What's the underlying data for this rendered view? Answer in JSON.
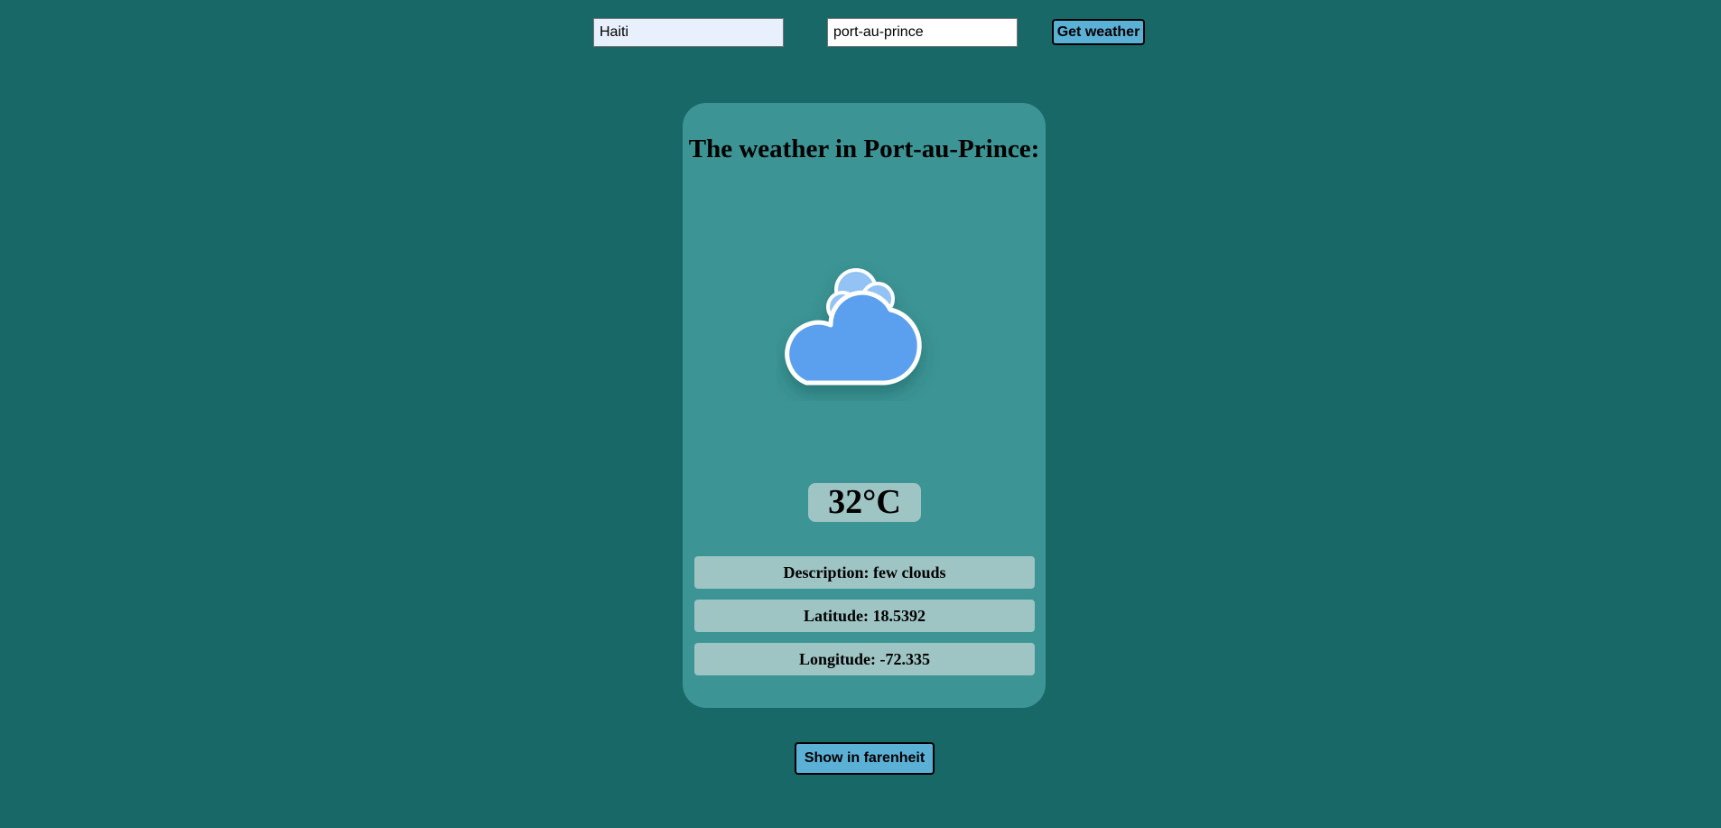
{
  "search": {
    "country_value": "Haiti",
    "city_value": "port-au-prince",
    "submit_label": "Get weather"
  },
  "weather": {
    "title": "The weather in Port-au-Prince:",
    "icon": "few-clouds-icon",
    "temperature": "32°C",
    "description": "Description: few clouds",
    "latitude": "Latitude: 18.5392",
    "longitude": "Longitude: -72.335"
  },
  "actions": {
    "toggle_unit_label": "Show in farenheit"
  },
  "colors": {
    "background": "#186868",
    "card": "#3c9494",
    "info_row": "#9ec4c4",
    "button": "#5bb0d6",
    "cloud_front": "#5aa0ee",
    "cloud_back": "#93c2f5"
  }
}
